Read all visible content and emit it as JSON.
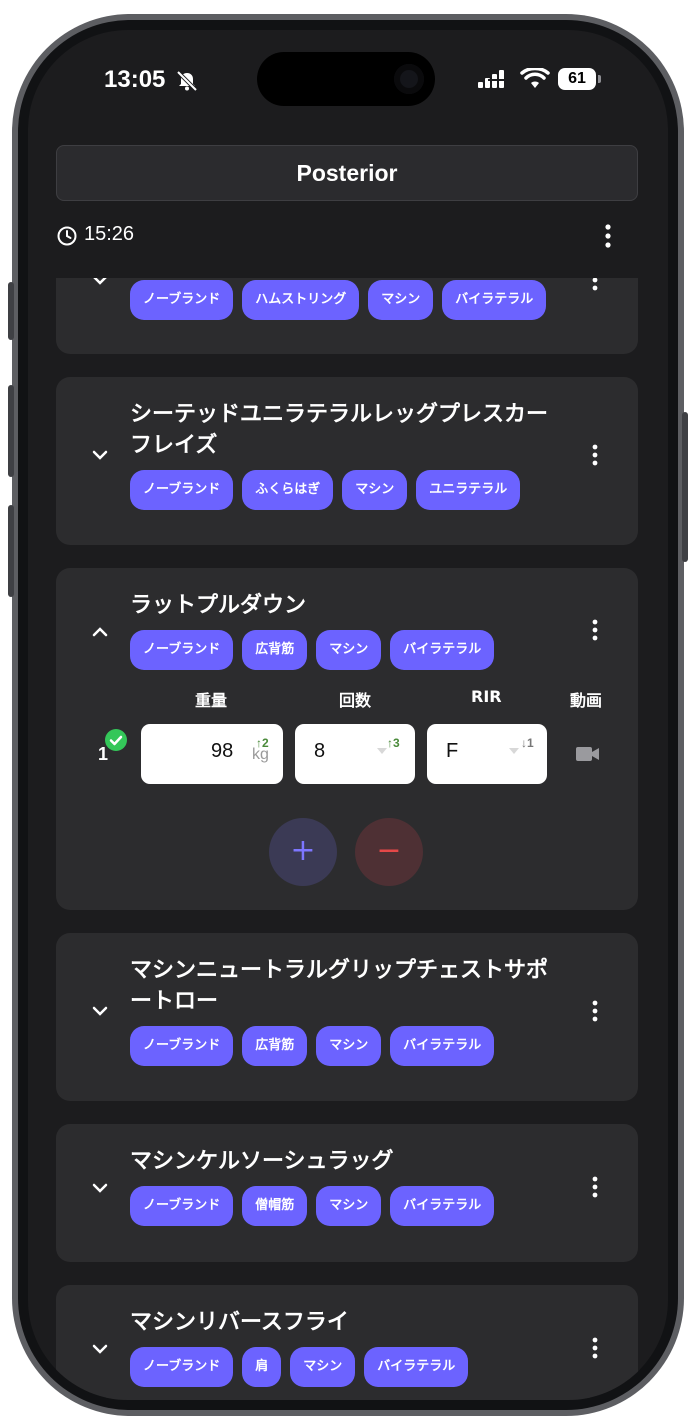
{
  "status_bar": {
    "time": "13:05",
    "battery": "61"
  },
  "header": {
    "title": "Posterior",
    "timer": "15:26"
  },
  "cards": [
    {
      "name": "",
      "tags": [
        "ノーブランド",
        "ハムストリング",
        "マシン",
        "バイラテラル"
      ]
    },
    {
      "name": "シーテッドユニラテラルレッグプレスカーフレイズ",
      "tags": [
        "ノーブランド",
        "ふくらはぎ",
        "マシン",
        "ユニラテラル"
      ]
    },
    {
      "name": "ラットプルダウン",
      "tags": [
        "ノーブランド",
        "広背筋",
        "マシン",
        "バイラテラル"
      ]
    },
    {
      "name": "マシンニュートラルグリップチェストサポートロー",
      "tags": [
        "ノーブランド",
        "広背筋",
        "マシン",
        "バイラテラル"
      ]
    },
    {
      "name": "マシンケルソーシュラッグ",
      "tags": [
        "ノーブランド",
        "僧帽筋",
        "マシン",
        "バイラテラル"
      ]
    },
    {
      "name": "マシンリバースフライ",
      "tags": [
        "ノーブランド",
        "肩",
        "マシン",
        "バイラテラル"
      ]
    }
  ],
  "set_table": {
    "columns": {
      "weight": "重量",
      "reps": "回数",
      "rir": "RIR",
      "video": "動画"
    },
    "rows": [
      {
        "set": "1",
        "weight": "98",
        "unit": "kg",
        "weight_hint": "↑2",
        "reps": "8",
        "reps_hint": "↑3",
        "rir": "F",
        "rir_hint": "↓1"
      }
    ],
    "add_label": "+",
    "remove_label": "−"
  },
  "colors": {
    "accent": "#6c63ff",
    "card": "#2c2c2e",
    "background": "#1c1c1e",
    "hint_green": "#4a8a3a",
    "done": "#34c759"
  },
  "icons": [
    "bell-slash-icon",
    "signal-icon",
    "wifi-icon",
    "battery-icon",
    "clock-icon",
    "more-vertical-icon",
    "chevron-down-icon",
    "chevron-up-icon",
    "check-icon",
    "video-camera-icon",
    "plus-icon",
    "minus-icon"
  ]
}
